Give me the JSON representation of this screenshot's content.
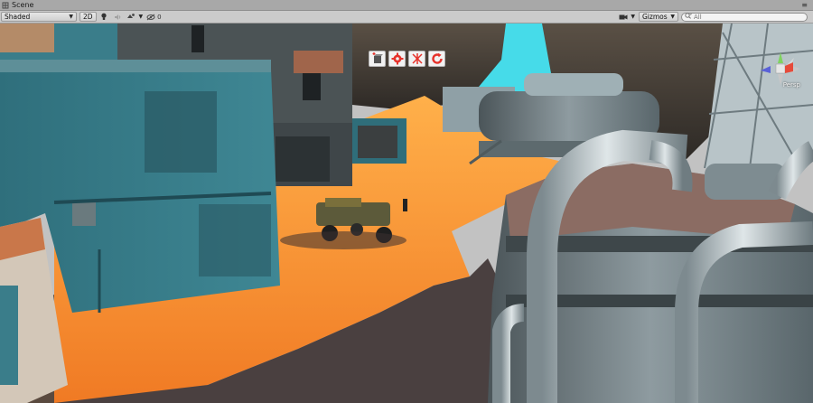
{
  "window": {
    "tab_label": "Scene"
  },
  "toolbar": {
    "shading_mode": "Shaded",
    "mode_2d": "2D",
    "hidden_count": "0",
    "gizmos_label": "Gizmos",
    "search_placeholder": "All"
  },
  "viewport": {
    "projection_label": "Persp"
  },
  "icons": {
    "tab": "scene-icon",
    "lighting": "light-bulb-icon",
    "audio": "speaker-icon",
    "effects": "effects-icon",
    "hidden": "eye-slash-icon",
    "camera": "camera-icon",
    "search": "search-icon",
    "tools": [
      "add-object-icon",
      "settings-icon",
      "snap-icon",
      "refresh-icon"
    ]
  },
  "colors": {
    "sky": "#3fd6e6",
    "sand": "#f08a2a",
    "tool_accent": "#e6322b"
  }
}
